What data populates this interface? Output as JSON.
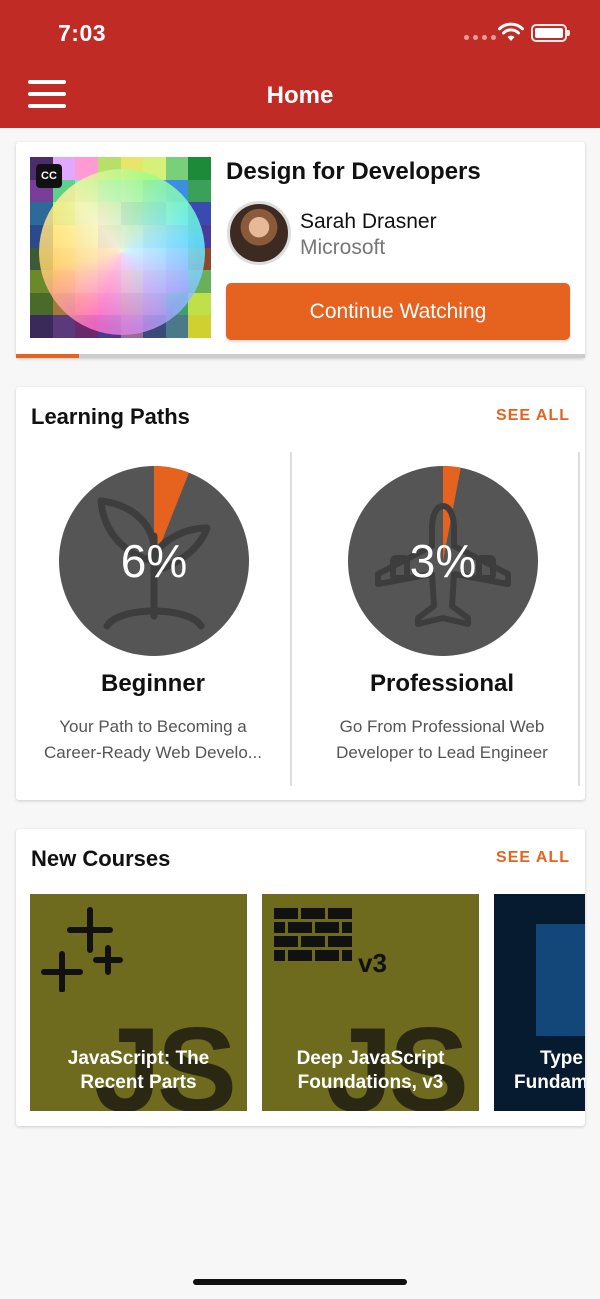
{
  "status": {
    "time": "7:03"
  },
  "header": {
    "title": "Home"
  },
  "continue_card": {
    "course_title": "Design for Developers",
    "author_name": "Sarah Drasner",
    "author_org": "Microsoft",
    "button_label": "Continue Watching",
    "cc_label": "CC",
    "progress": 0.11
  },
  "learning_paths": {
    "title": "Learning Paths",
    "see_all": "SEE ALL",
    "items": [
      {
        "percent_label": "6%",
        "percent": 6,
        "name": "Beginner",
        "description_line1": "Your Path to Becoming a",
        "description_line2": "Career-Ready Web Develo...",
        "icon": "plant-icon"
      },
      {
        "percent_label": "3%",
        "percent": 3,
        "name": "Professional",
        "description_line1": "Go From Professional Web",
        "description_line2": "Developer to Lead Engineer",
        "icon": "airplane-icon"
      }
    ]
  },
  "new_courses": {
    "title": "New Courses",
    "see_all": "SEE ALL",
    "items": [
      {
        "line1": "JavaScript: The",
        "line2": "Recent Parts",
        "art": "JS"
      },
      {
        "line1": "Deep JavaScript",
        "line2": "Foundations, v3",
        "art": "JS"
      },
      {
        "line1": "Type",
        "line2": "Fundam"
      }
    ]
  },
  "colors": {
    "brand_red": "#c02b25",
    "accent_orange": "#e5621f",
    "pie_gray": "#555555"
  }
}
